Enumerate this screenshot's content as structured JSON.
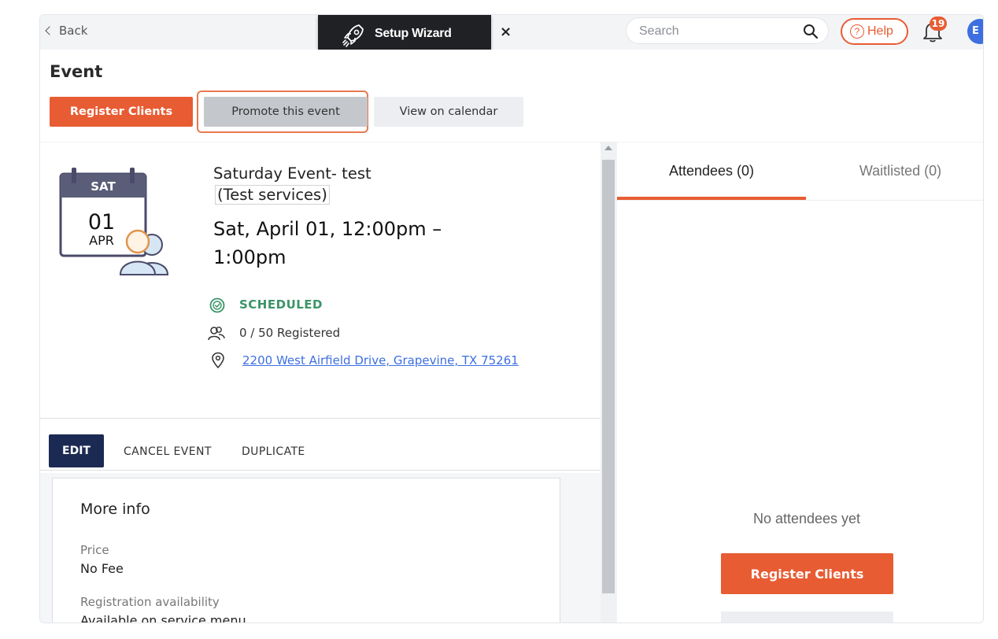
{
  "topbar": {
    "back_label": "Back",
    "wizard_label": "Setup Wizard",
    "wizard_close": "×",
    "search_placeholder": "Search",
    "help_label": "Help",
    "help_glyph": "?",
    "notification_count": "19",
    "avatar_initials": "E"
  },
  "header": {
    "title": "Event",
    "register_label": "Register Clients",
    "promote_label": "Promote this event",
    "calendar_label": "View on calendar"
  },
  "event": {
    "day": "SAT",
    "date_num": "01",
    "month": "APR",
    "name": "Saturday Event- test",
    "services": "(Test services)",
    "datetime": "Sat, April 01, 12:00pm – 1:00pm",
    "status": "SCHEDULED",
    "registered": "0 / 50 Registered",
    "address": "2200 West Airfield Drive, Grapevine, TX 75261"
  },
  "actions": {
    "edit": "EDIT",
    "cancel": "CANCEL EVENT",
    "duplicate": "DUPLICATE"
  },
  "more_info": {
    "title": "More info",
    "price_label": "Price",
    "price_value": "No Fee",
    "availability_label": "Registration availability",
    "availability_value": "Available on service menu"
  },
  "right_panel": {
    "tab_attendees": "Attendees (0)",
    "tab_waitlisted": "Waitlisted (0)",
    "empty_text": "No attendees yet",
    "register_label": "Register Clients"
  },
  "colors": {
    "accent": "#e85c33",
    "navy": "#1b2a52",
    "status_green": "#3b9467",
    "link_blue": "#3d6fe0"
  }
}
